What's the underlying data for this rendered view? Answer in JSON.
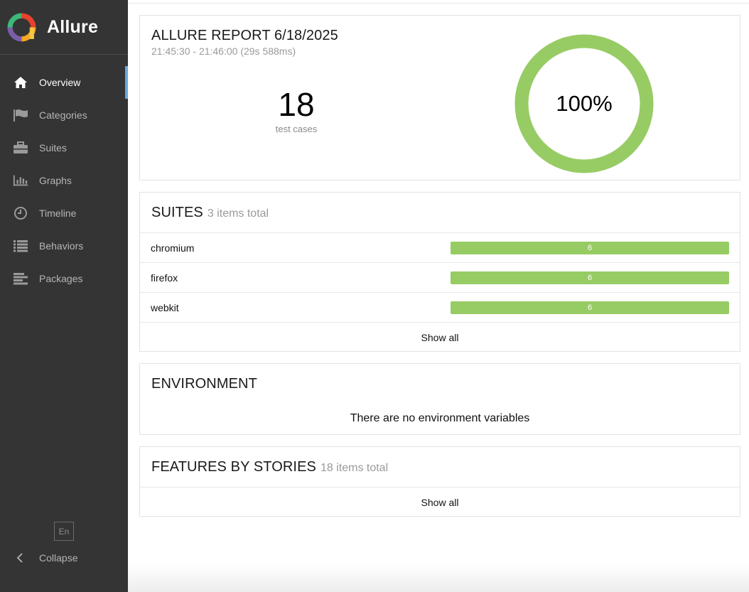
{
  "brand": {
    "name": "Allure"
  },
  "sidebar": {
    "items": [
      {
        "label": "Overview",
        "icon": "home-icon",
        "active": true
      },
      {
        "label": "Categories",
        "icon": "flag-icon"
      },
      {
        "label": "Suites",
        "icon": "briefcase-icon"
      },
      {
        "label": "Graphs",
        "icon": "bar-chart-icon"
      },
      {
        "label": "Timeline",
        "icon": "clock-icon"
      },
      {
        "label": "Behaviors",
        "icon": "list-icon"
      },
      {
        "label": "Packages",
        "icon": "align-left-icon"
      }
    ],
    "language": "En",
    "collapse_label": "Collapse"
  },
  "summary": {
    "title": "ALLURE REPORT 6/18/2025",
    "time_range": "21:45:30 - 21:46:00 (29s 588ms)",
    "test_count": "18",
    "test_count_label": "test cases",
    "pass_rate": "100%",
    "pass_fraction": 1.0,
    "donut_color": "#97cc64"
  },
  "suites": {
    "title": "SUITES",
    "total_label": "3 items total",
    "rows": [
      {
        "name": "chromium",
        "passed": "6"
      },
      {
        "name": "firefox",
        "passed": "6"
      },
      {
        "name": "webkit",
        "passed": "6"
      }
    ],
    "show_all": "Show all",
    "bar_color": "#97cc64"
  },
  "environment": {
    "title": "ENVIRONMENT",
    "empty_text": "There are no environment variables"
  },
  "features": {
    "title": "FEATURES BY STORIES",
    "total_label": "18 items total",
    "show_all": "Show all"
  }
}
